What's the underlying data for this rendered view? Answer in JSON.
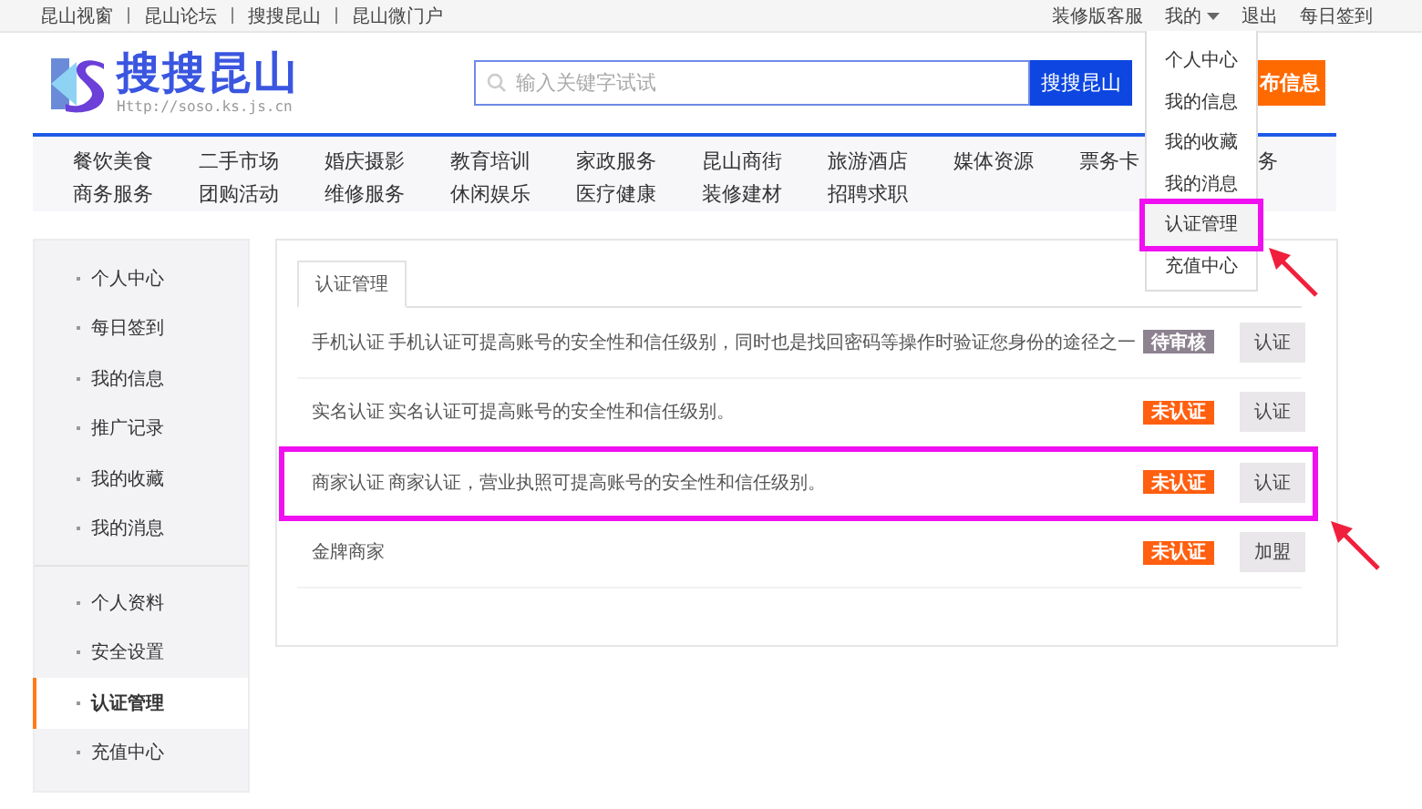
{
  "top_links": [
    "昆山视窗",
    "昆山论坛",
    "搜搜昆山",
    "昆山微门户"
  ],
  "top_right": [
    {
      "label": "装修版客服",
      "kind": "link"
    },
    {
      "label": "我的",
      "kind": "menu"
    },
    {
      "label": "退出",
      "kind": "link"
    },
    {
      "label": "每日签到",
      "kind": "link"
    }
  ],
  "logo": {
    "name": "搜搜昆山",
    "url": "Http://soso.ks.js.cn"
  },
  "search": {
    "placeholder": "输入关键字试试",
    "button": "搜搜昆山"
  },
  "publish_button": "布信息",
  "nav": [
    [
      "餐饮美食",
      "二手市场",
      "婚庆摄影",
      "教育培训",
      "家政服务",
      "昆山商街",
      "旅游酒店",
      "媒体资源",
      "票务卡",
      "务"
    ],
    [
      "商务服务",
      "团购活动",
      "维修服务",
      "休闲娱乐",
      "医疗健康",
      "装修建材",
      "招聘求职"
    ]
  ],
  "user_menu": {
    "expanded": true,
    "items": [
      {
        "label": "个人中心",
        "highlighted": false
      },
      {
        "label": "我的信息",
        "highlighted": false
      },
      {
        "label": "我的收藏",
        "highlighted": false
      },
      {
        "label": "我的消息",
        "highlighted": false
      },
      {
        "label": "认证管理",
        "highlighted": true
      },
      {
        "label": "充值中心",
        "highlighted": false
      }
    ]
  },
  "sidebar": {
    "groups": [
      [
        {
          "label": "个人中心",
          "selected": false
        },
        {
          "label": "每日签到",
          "selected": false
        },
        {
          "label": "我的信息",
          "selected": false
        },
        {
          "label": "推广记录",
          "selected": false
        },
        {
          "label": "我的收藏",
          "selected": false
        },
        {
          "label": "我的消息",
          "selected": false
        }
      ],
      [
        {
          "label": "个人资料",
          "selected": false
        },
        {
          "label": "安全设置",
          "selected": false
        },
        {
          "label": "认证管理",
          "selected": true
        },
        {
          "label": "充值中心",
          "selected": false
        }
      ]
    ]
  },
  "tabs": [
    {
      "label": "认证管理",
      "selected": true
    }
  ],
  "verifications": [
    {
      "name": "手机认证",
      "description": "手机认证可提高账号的安全性和信任级别，同时也是找回密码等操作时验证您身份的途径之一",
      "status": "待审核",
      "color": "#8d8290",
      "action": "认证",
      "highlighted": false
    },
    {
      "name": "实名认证",
      "description": "实名认证可提高账号的安全性和信任级别。",
      "status": "未认证",
      "color": "#ff5f0f",
      "action": "认证",
      "highlighted": false
    },
    {
      "name": "商家认证",
      "description": "商家认证，营业执照可提高账号的安全性和信任级别。",
      "status": "未认证",
      "color": "#ff5f0f",
      "action": "认证",
      "highlighted": true
    },
    {
      "name": "金牌商家",
      "status": "未认证",
      "color": "#ff5f0f",
      "action": "加盟",
      "highlighted": false
    }
  ]
}
